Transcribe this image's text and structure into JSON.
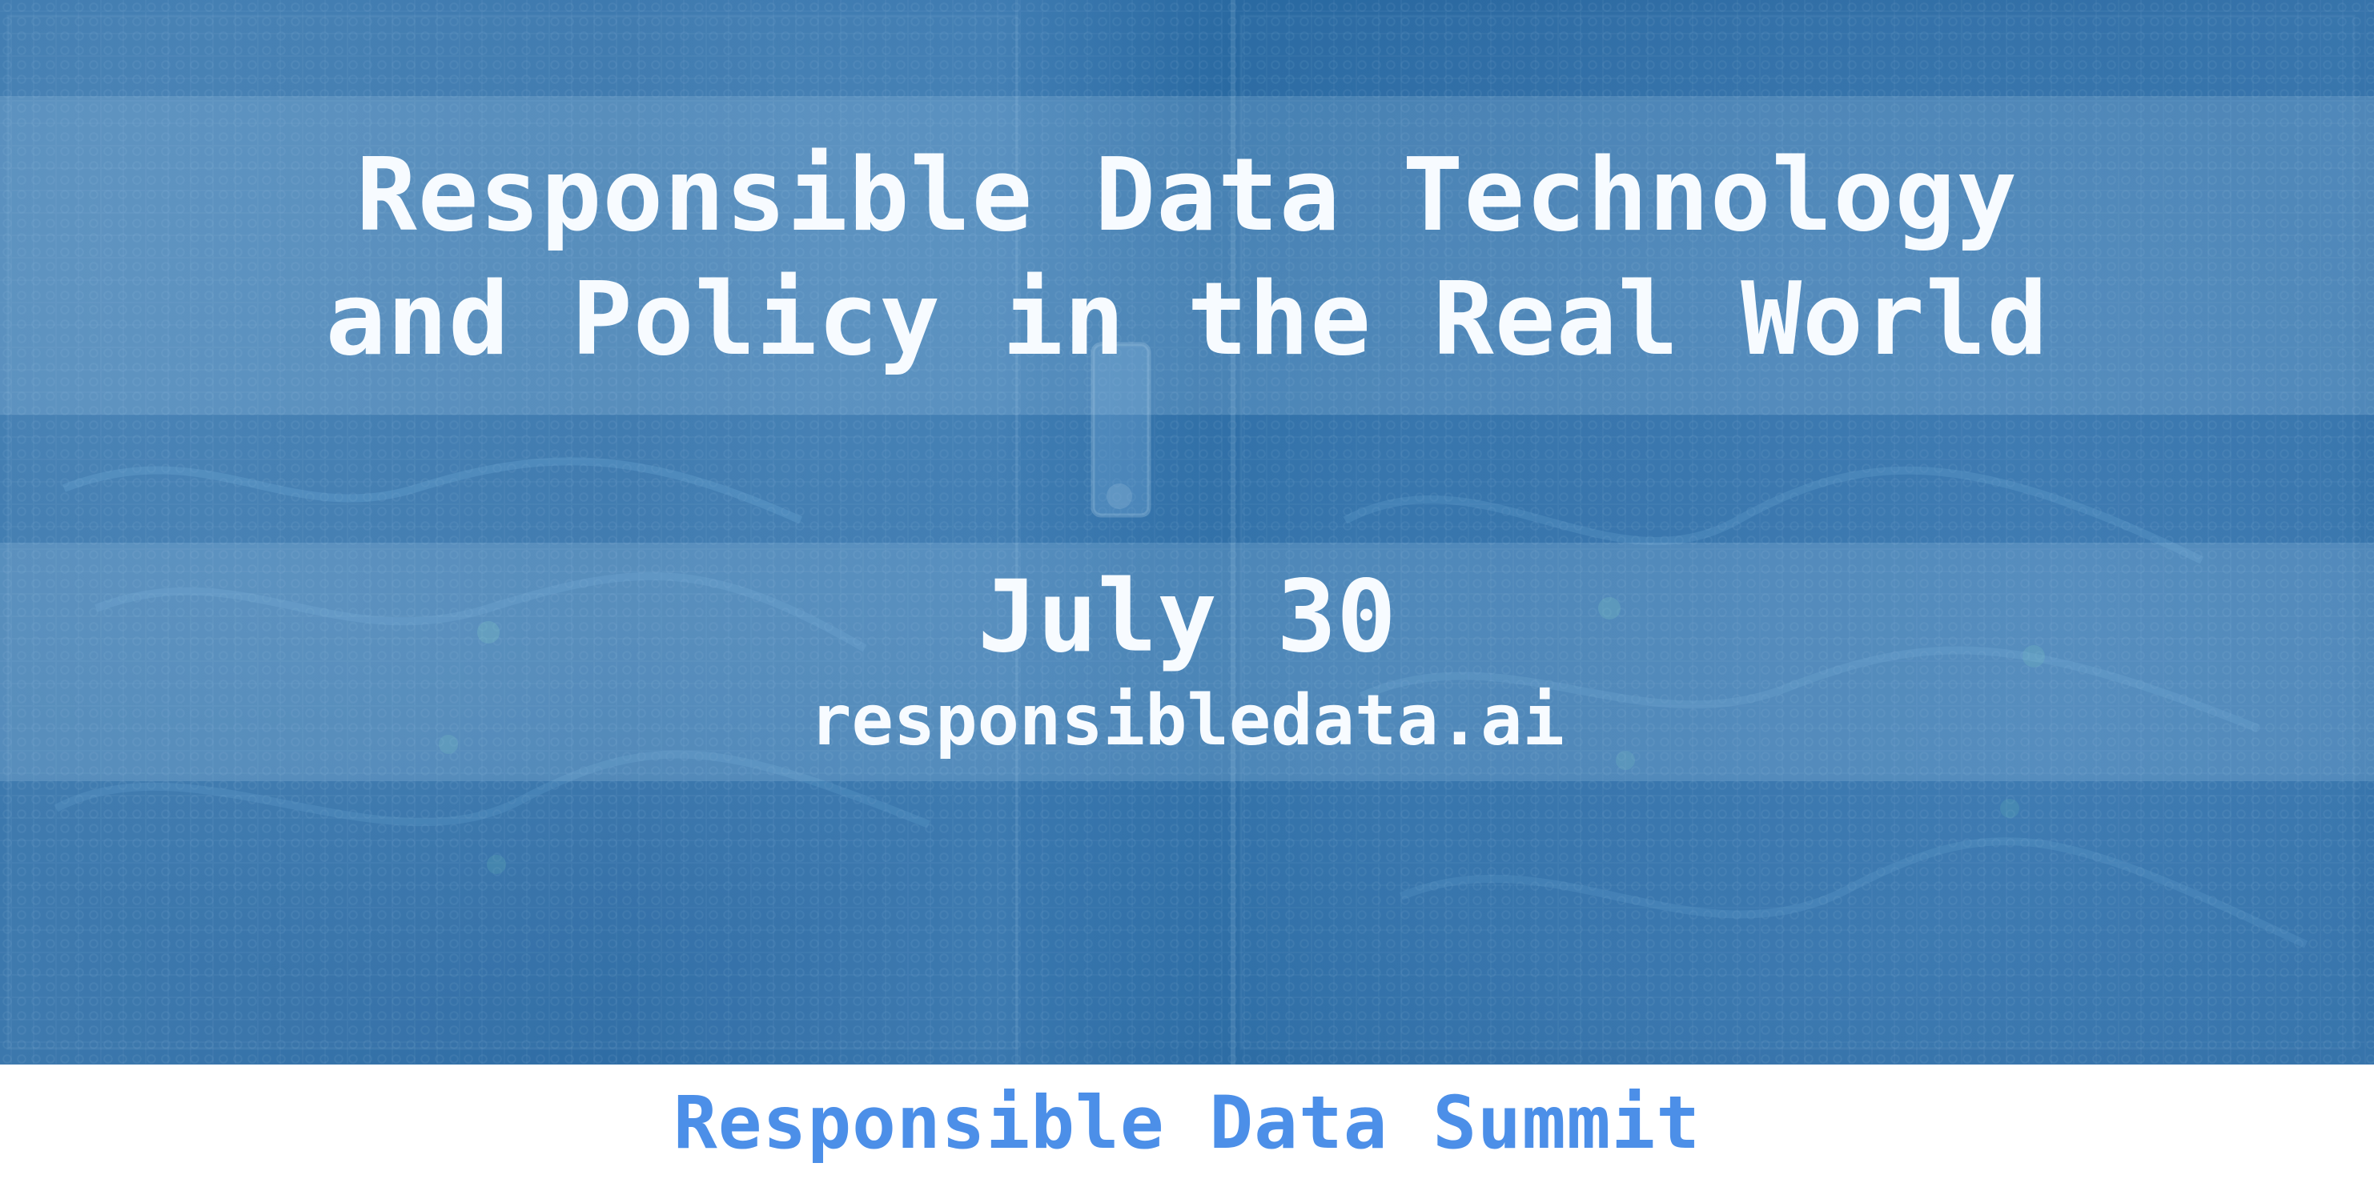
{
  "hero": {
    "title": "Responsible Data Technology\nand Policy in the Real World",
    "date": "July 30",
    "website": "responsibledata.ai"
  },
  "footer": {
    "summit_name": "Responsible Data Summit"
  },
  "colors": {
    "background_blue": "#2f6fa6",
    "text_white": "#f7fbff",
    "footer_blue": "#4c8fe8"
  }
}
